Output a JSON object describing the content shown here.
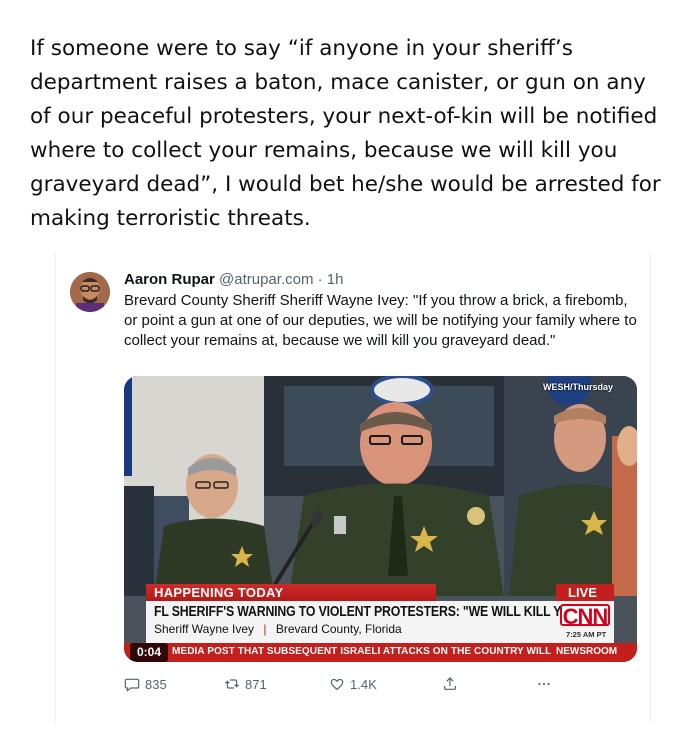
{
  "caption": {
    "text": "If someone were to say “if anyone in your sheriff’s department raises a baton, mace canister, or gun on any of our peaceful protesters, your next-of-kin will be notified where to collect your remains, because we will kill you graveyard dead”, I would bet he/she would be arrested for making terroristic threats."
  },
  "tweet": {
    "author_name": "Aaron Rupar",
    "author_handle": "@atrupar.com",
    "separator": "·",
    "time": "1h",
    "text": "Brevard County Sheriff Sheriff Wayne Ivey: \"If you throw a brick, a firebomb, or point a gun at one of our deputies, we will be notifying your family where to collect your remains at, because we will kill you graveyard dead.\"",
    "media": {
      "source_tag": "WESH/Thursday",
      "happening": "HAPPENING TODAY",
      "live": "LIVE",
      "headline": "FL SHERIFF'S WARNING TO VIOLENT PROTESTERS: \"WE WILL KILL YOU...\"",
      "sub_name": "Sheriff Wayne Ivey",
      "sub_sep": "|",
      "sub_location": "Brevard County, Florida",
      "network": "CNN",
      "clock": "7:25 AM PT",
      "timestamp": "0:04",
      "ticker": "MEDIA POST THAT SUBSEQUENT ISRAELI ATTACKS ON THE COUNTRY WILL BE \"EVI",
      "program": "NEWSROOM"
    },
    "actions": {
      "replies": "835",
      "reposts": "871",
      "likes": "1.4K"
    }
  },
  "icons": [
    "reply-icon",
    "repost-icon",
    "like-icon",
    "share-icon",
    "more-icon"
  ],
  "colors": {
    "cnn_red": "#c21f1d",
    "muted_text": "#536471"
  }
}
